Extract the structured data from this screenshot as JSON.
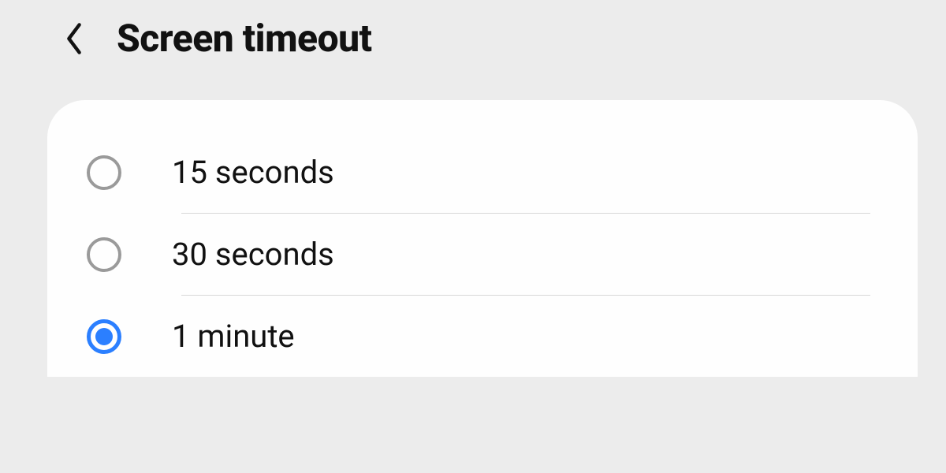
{
  "header": {
    "title": "Screen timeout"
  },
  "options": [
    {
      "label": "15 seconds",
      "selected": false
    },
    {
      "label": "30 seconds",
      "selected": false
    },
    {
      "label": "1 minute",
      "selected": true
    }
  ]
}
